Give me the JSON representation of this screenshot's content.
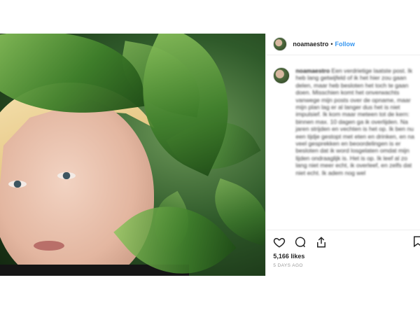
{
  "header": {
    "username": "noamaestro",
    "separator": "•",
    "follow_label": "Follow"
  },
  "caption": {
    "username": "noamaestro",
    "text": "Een verdrietige laatste post. Ik heb lang getwijfeld of ik het hier zou gaan delen, maar heb besloten het toch te gaan doen. Misschien komt het onverwachts vanwege mijn posts over de opname, maar mijn plan lag er al langer dus het is niet impulsief. Ik kom maar meteen tot de kern: binnen max. 10 dagen ga ik overlijden. Na jaren strijden en vechten is het op. Ik ben nu een tijdje gestopt met eten en drinken, en na veel gesprekken en beoordelingen is er besloten dat ik word losgelaten omdat mijn lijden ondraaglijk is. Het is op. Ik leef al zo lang niet meer echt, ik overleef, en zelfs dat niet echt. Ik adem nog wel"
  },
  "stats": {
    "likes": "5,166 likes",
    "time_ago": "5 DAYS AGO"
  },
  "icons": [
    "heart-icon",
    "comment-icon",
    "share-icon",
    "bookmark-icon"
  ]
}
